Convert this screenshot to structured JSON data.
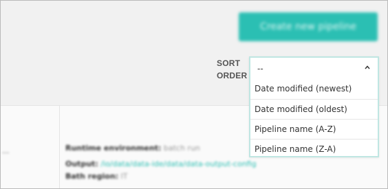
{
  "header": {
    "create_pipeline_label": "Create new pipeline"
  },
  "sort": {
    "label": "SORT ORDER",
    "selected_value": "--",
    "options": [
      "Date modified (newest)",
      "Date modified (oldest)",
      "Pipeline name (A-Z)",
      "Pipeline name (Z-A)"
    ]
  },
  "pipeline_card": {
    "left_snippet": "...",
    "runtime_label": "Runtime environment:",
    "runtime_value": "batch run",
    "output_label": "Output:",
    "output_value": "/io/data/data-ide/data/data-output-config",
    "region_label": "Bath region:",
    "region_value": "IT"
  },
  "colors": {
    "accent": "#2bbfb3"
  }
}
